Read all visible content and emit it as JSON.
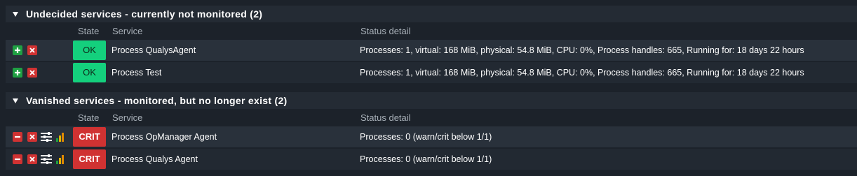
{
  "colors": {
    "ok": "#14d07d",
    "crit": "#d03232",
    "add": "#1fa043",
    "background": "#1c222a",
    "header": "#242b34"
  },
  "undecided": {
    "title": "Undecided services - currently not monitored (2)",
    "columns": {
      "state": "State",
      "service": "Service",
      "detail": "Status detail"
    },
    "rows": [
      {
        "state": "OK",
        "service": "Process QualysAgent",
        "detail": "Processes: 1, virtual: 168 MiB, physical: 54.8 MiB, CPU: 0%, Process handles: 665, Running for: 18 days 22 hours",
        "icons": [
          "plus-icon",
          "close-icon"
        ]
      },
      {
        "state": "OK",
        "service": "Process Test",
        "detail": "Processes: 1, virtual: 168 MiB, physical: 54.8 MiB, CPU: 0%, Process handles: 665, Running for: 18 days 22 hours",
        "icons": [
          "plus-icon",
          "close-icon"
        ]
      }
    ]
  },
  "vanished": {
    "title": "Vanished services - monitored, but no longer exist (2)",
    "columns": {
      "state": "State",
      "service": "Service",
      "detail": "Status detail"
    },
    "rows": [
      {
        "state": "CRIT",
        "service": "Process OpManager Agent",
        "detail": "Processes: 0 (warn/crit below 1/1)",
        "icons": [
          "minus-icon",
          "close-icon",
          "sliders-icon",
          "bar-chart-icon"
        ]
      },
      {
        "state": "CRIT",
        "service": "Process Qualys Agent",
        "detail": "Processes: 0 (warn/crit below 1/1)",
        "icons": [
          "minus-icon",
          "close-icon",
          "sliders-icon",
          "bar-chart-icon"
        ]
      }
    ]
  }
}
